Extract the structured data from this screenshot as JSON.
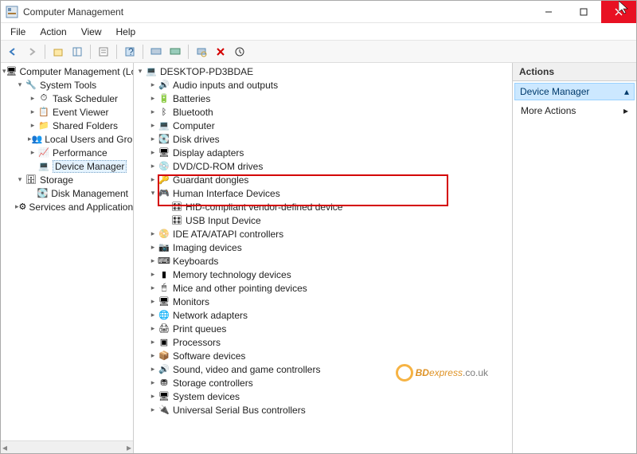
{
  "window": {
    "title": "Computer Management"
  },
  "menu": {
    "file": "File",
    "action": "Action",
    "view": "View",
    "help": "Help"
  },
  "left": {
    "root": "Computer Management (Local",
    "systools": "System Tools",
    "tasksched": "Task Scheduler",
    "eventviewer": "Event Viewer",
    "sharedfolders": "Shared Folders",
    "localusers": "Local Users and Groups",
    "performance": "Performance",
    "devicemgr": "Device Manager",
    "storage": "Storage",
    "diskmgmt": "Disk Management",
    "services": "Services and Applications"
  },
  "center": {
    "root": "DESKTOP-PD3BDAE",
    "audio": "Audio inputs and outputs",
    "batteries": "Batteries",
    "bluetooth": "Bluetooth",
    "computer": "Computer",
    "disk": "Disk drives",
    "display": "Display adapters",
    "dvd": "DVD/CD-ROM drives",
    "guardant": "Guardant dongles",
    "hid": "Human Interface Devices",
    "hid1": "HID-compliant vendor-defined device",
    "hid2": "USB Input Device",
    "ide": "IDE ATA/ATAPI controllers",
    "imaging": "Imaging devices",
    "keyboards": "Keyboards",
    "memtech": "Memory technology devices",
    "mice": "Mice and other pointing devices",
    "monitors": "Monitors",
    "network": "Network adapters",
    "printq": "Print queues",
    "processors": "Processors",
    "software": "Software devices",
    "sound": "Sound, video and game controllers",
    "storagectl": "Storage controllers",
    "systemdev": "System devices",
    "usb": "Universal Serial Bus controllers"
  },
  "right": {
    "header": "Actions",
    "selected": "Device Manager",
    "more": "More Actions"
  },
  "watermark": {
    "text1": "BD",
    "text2": "express",
    "text3": ".co.uk"
  }
}
